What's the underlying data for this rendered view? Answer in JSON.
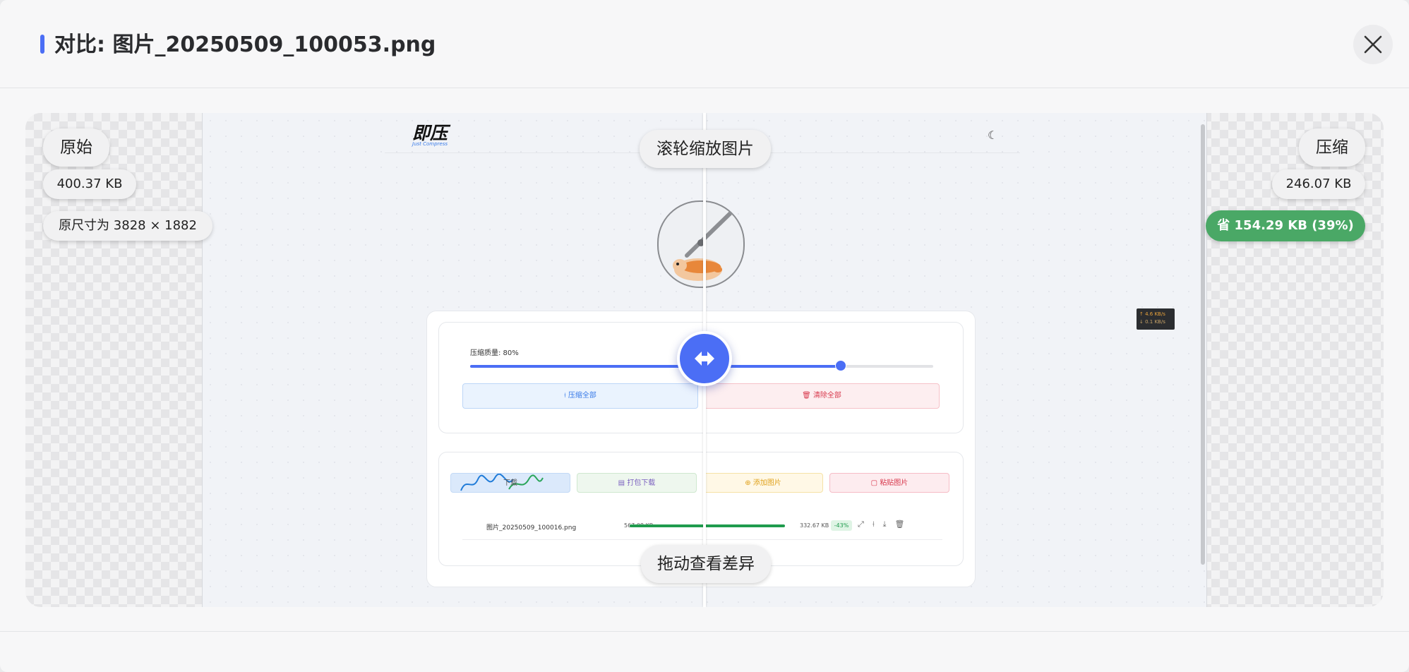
{
  "dialog": {
    "title": "对比: 图片_20250509_100053.png",
    "close_icon": "close-icon"
  },
  "original": {
    "label": "原始",
    "size": "400.37 KB",
    "dimensions": "原尺寸为 3828 × 1882"
  },
  "compressed": {
    "label": "压缩",
    "size": "246.07 KB",
    "savings": "省 154.29 KB (39%)"
  },
  "hints": {
    "zoom": "滚轮缩放图片",
    "drag": "拖动查看差异"
  },
  "divider_position_percent": 50,
  "preview": {
    "logo_text": "即压",
    "logo_sub": "Just Compress",
    "quality_label": "压缩质量: 80%",
    "quality_value_percent": 80,
    "compress_all": "压缩全部",
    "clear_all": "清除全部",
    "toolbar": [
      "下载",
      "打包下载",
      "添加图片",
      "粘贴图片"
    ],
    "file": {
      "name": "图片_20250509_100016.png",
      "original": "567.08 KB",
      "compressed": "332.67 KB",
      "change": "-43%"
    },
    "speed_up": "↑ 4.6 KB/s",
    "speed_down": "↓ 0.1 KB/s"
  },
  "colors": {
    "accent": "#4b6ef5",
    "savings": "#4aa866"
  }
}
